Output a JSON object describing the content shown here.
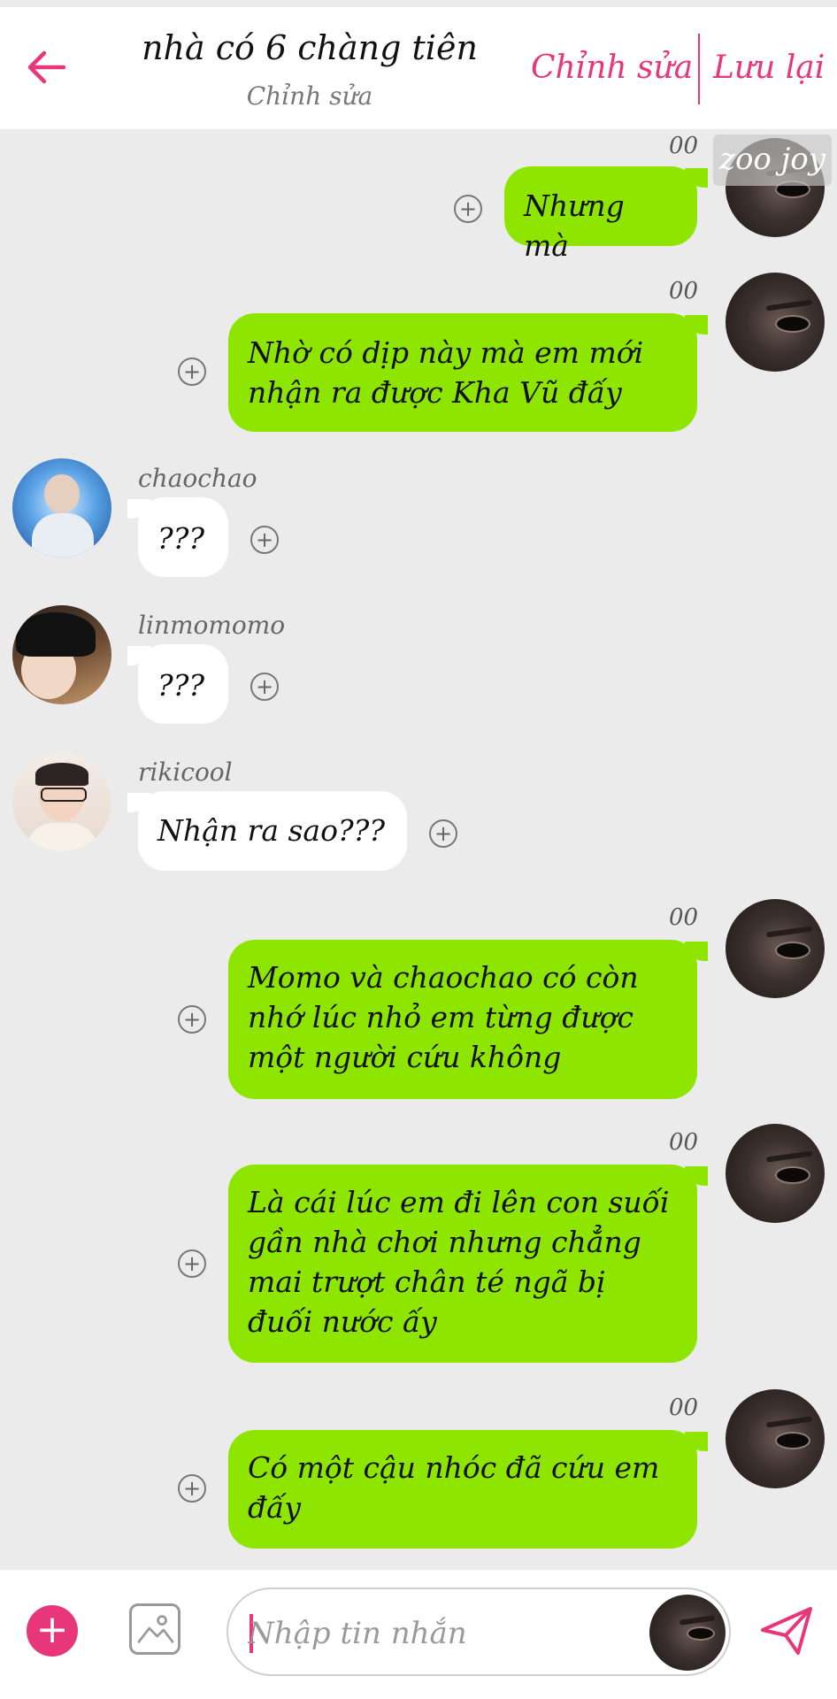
{
  "header": {
    "title": "nhà có 6 chàng tiên",
    "subtitle": "Chỉnh sửa",
    "edit_label": "Chỉnh sửa",
    "save_label": "Lưu lại"
  },
  "badge": {
    "text": "zoo joy"
  },
  "messages": [
    {
      "sender": "me",
      "status": "00",
      "text": "Nhưng mà"
    },
    {
      "sender": "me",
      "status": "00",
      "text": "Nhờ có dịp này mà em mới nhận ra được Kha Vũ đấy"
    },
    {
      "sender": "chaochao",
      "name": "chaochao",
      "text": "???"
    },
    {
      "sender": "linmomomo",
      "name": "linmomomo",
      "text": "???"
    },
    {
      "sender": "rikicool",
      "name": "rikicool",
      "text": "Nhận ra sao???"
    },
    {
      "sender": "me",
      "status": "00",
      "text": "Momo và chaochao có còn nhớ lúc nhỏ em từng được một người cứu không"
    },
    {
      "sender": "me",
      "status": "00",
      "text": "Là cái lúc em đi lên con suối gần nhà chơi nhưng chẳng mai trượt chân té ngã bị đuối nước ấy"
    },
    {
      "sender": "me",
      "status": "00",
      "text": "Có một cậu nhóc đã cứu em đấy"
    }
  ],
  "composer": {
    "placeholder": "Nhập tin nhắn"
  },
  "icons": {
    "back": "arrow-left-icon",
    "add": "plus-circle-icon",
    "image": "image-icon",
    "send": "send-icon",
    "message_plus": "plus-icon"
  },
  "colors": {
    "accent": "#e8367a",
    "outgoing_bubble": "#8ee500",
    "incoming_bubble": "#ffffff",
    "chat_background": "#ebebeb"
  }
}
